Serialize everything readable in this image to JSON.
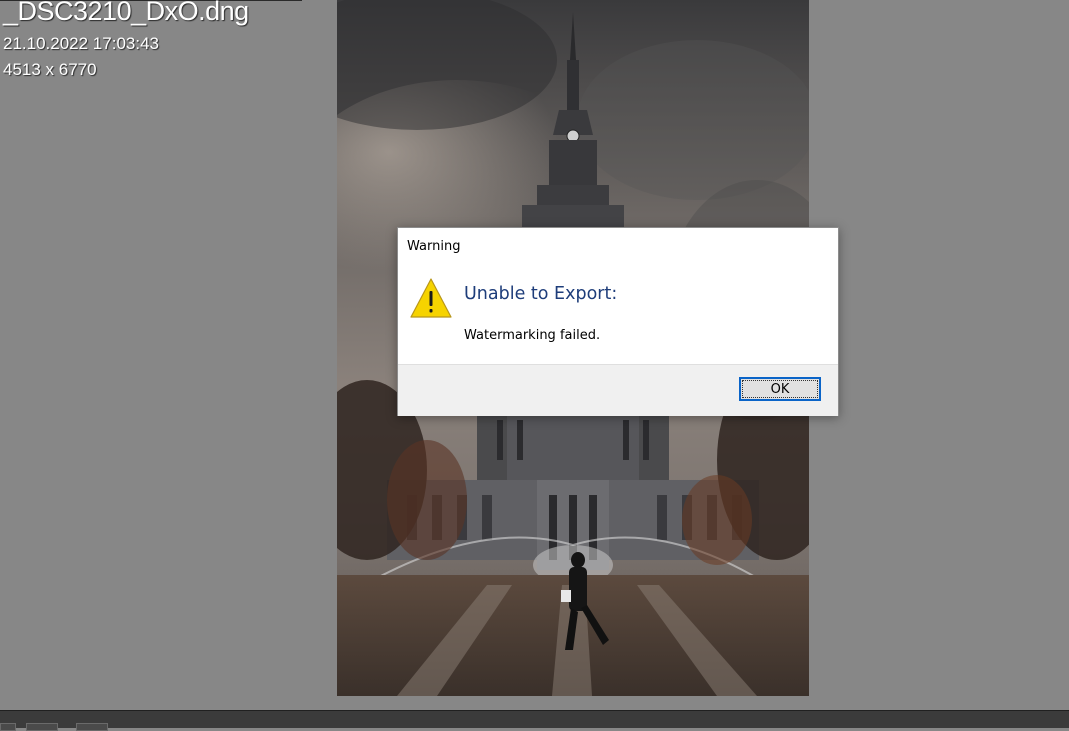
{
  "image_info": {
    "filename": "_DSC3210_DxO.dng",
    "datetime": "21.10.2022 17:03:43",
    "dimensions": "4513 x 6770"
  },
  "dialog": {
    "title": "Warning",
    "icon": "warning-icon",
    "heading": "Unable to Export:",
    "message": "Watermarking failed.",
    "ok_label": "OK"
  },
  "colors": {
    "background": "#878787",
    "heading": "#1e3d7a",
    "ok_focus_border": "#0a64c8",
    "warning_yellow": "#f6d300"
  }
}
